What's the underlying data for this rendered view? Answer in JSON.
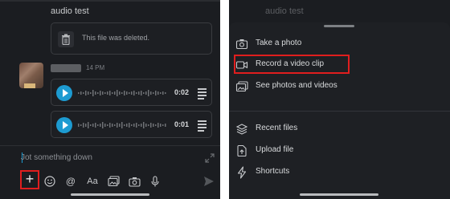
{
  "left": {
    "chat_title": "audio test",
    "deleted_file_text": "This file was deleted.",
    "message_time": "14 PM",
    "audio_clips": [
      {
        "duration": "0:02"
      },
      {
        "duration": "0:01"
      }
    ],
    "composer_placeholder": "Jot something down",
    "toolbar_icons": [
      "plus-icon",
      "emoji-icon",
      "mention-icon",
      "text-format-icon",
      "gallery-icon",
      "camera-icon",
      "microphone-icon",
      "send-icon"
    ],
    "toolbar_labels": {
      "mention": "@",
      "format": "Aa"
    }
  },
  "right": {
    "overlay_title": "audio test",
    "menu_items": [
      {
        "label": "Take a photo",
        "icon": "camera-icon"
      },
      {
        "label": "Record a video clip",
        "icon": "video-icon"
      },
      {
        "label": "See photos and videos",
        "icon": "gallery-icon"
      },
      {
        "label": "Recent files",
        "icon": "stack-icon"
      },
      {
        "label": "Upload file",
        "icon": "upload-icon"
      },
      {
        "label": "Shortcuts",
        "icon": "lightning-icon"
      }
    ]
  },
  "colors": {
    "highlight": "#e01e1e",
    "accent": "#1d9bd1",
    "background": "#1b1d21"
  }
}
